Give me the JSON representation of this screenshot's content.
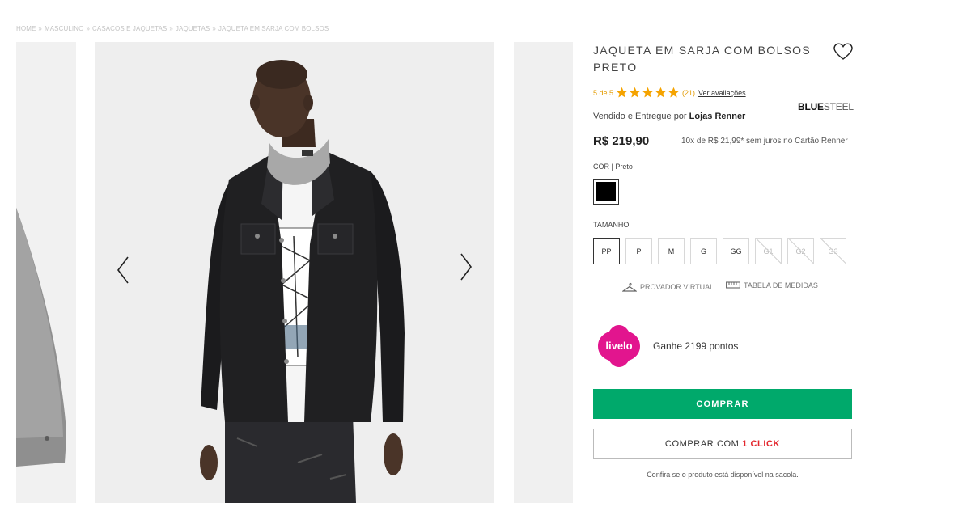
{
  "breadcrumb": [
    "HOME",
    "MASCULINO",
    "CASACOS E JAQUETAS",
    "JAQUETAS",
    "JAQUETA EM SARJA COM BOLSOS"
  ],
  "breadcrumb_sep": "»",
  "product": {
    "title_line1": "JAQUETA EM SARJA COM BOLSOS",
    "title_line2": "PRETO",
    "rating_text": "5 de 5",
    "rating_value": 5,
    "rating_max": 5,
    "review_count": "(21)",
    "see_reviews": "Ver avaliações",
    "seller_prefix": "Vendido e Entregue por",
    "seller_name": "Lojas Renner",
    "brand_bold": "BLUE",
    "brand_light": "STEEL",
    "price": "R$ 219,90",
    "installments": "10x de R$ 21,99* sem juros no Cartão Renner"
  },
  "color": {
    "label": "COR",
    "selected": "Preto",
    "swatch": "#000000"
  },
  "size": {
    "label": "TAMANHO",
    "options": [
      {
        "label": "PP",
        "selected": true,
        "available": true
      },
      {
        "label": "P",
        "selected": false,
        "available": true
      },
      {
        "label": "M",
        "selected": false,
        "available": true
      },
      {
        "label": "G",
        "selected": false,
        "available": true
      },
      {
        "label": "GG",
        "selected": false,
        "available": true
      },
      {
        "label": "G1",
        "selected": false,
        "available": false
      },
      {
        "label": "G2",
        "selected": false,
        "available": false
      },
      {
        "label": "G3",
        "selected": false,
        "available": false
      }
    ]
  },
  "tools": {
    "virtual_fitting": "PROVADOR VIRTUAL",
    "size_chart": "TABELA DE MEDIDAS"
  },
  "livelo": {
    "logo_text": "livelo",
    "points_text": "Ganhe 2199 pontos",
    "color": "#e2158e"
  },
  "actions": {
    "buy": "COMPRAR",
    "buy_one_click_prefix": "COMPRAR COM ",
    "buy_one_click_highlight": "1 CLICK",
    "availability_note": "Confira se o produto está disponível na sacola."
  },
  "colors": {
    "buy_button": "#00a96b",
    "star": "#f5a300",
    "one_click_accent": "#e3262d"
  }
}
